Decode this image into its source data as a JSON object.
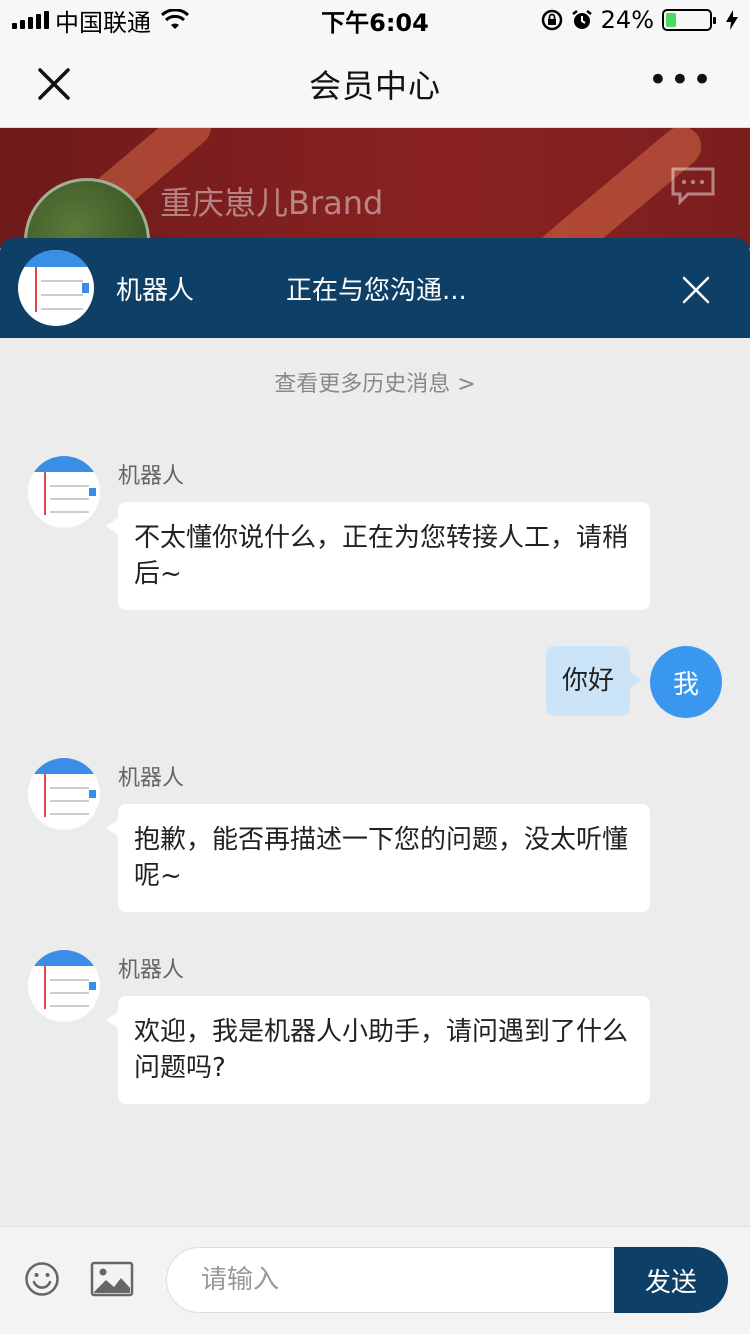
{
  "status_bar": {
    "carrier": "中国联通",
    "time": "下午6:04",
    "battery_percent": "24%",
    "battery_level": 0.24,
    "icons": [
      "signal-icon",
      "wifi-icon",
      "orientation-lock-icon",
      "alarm-icon",
      "battery-icon",
      "charging-icon"
    ]
  },
  "nav": {
    "title": "会员中心",
    "close_icon": "close-icon",
    "more_icon": "more-icon"
  },
  "profile": {
    "name": "重庆崽儿Brand"
  },
  "chat_header": {
    "bot_name": "机器人",
    "status": "正在与您沟通..."
  },
  "history_link": "查看更多历史消息 >",
  "messages": [
    {
      "sender": "机器人",
      "text": "不太懂你说什么，正在为您转接人工，请稍后~"
    },
    {
      "sender": "我",
      "text": "你好"
    },
    {
      "sender": "机器人",
      "text": "抱歉，能否再描述一下您的问题，没太听懂呢~"
    },
    {
      "sender": "机器人",
      "text": "欢迎，我是机器人小助手，请问遇到了什么问题吗?"
    }
  ],
  "input": {
    "placeholder": "请输入",
    "value": "",
    "send_label": "发送"
  },
  "colors": {
    "header_navy": "#0e3f66",
    "user_avatar_blue": "#3a97f0",
    "user_bubble": "#cce4f7",
    "profile_red": "#8b2222"
  }
}
